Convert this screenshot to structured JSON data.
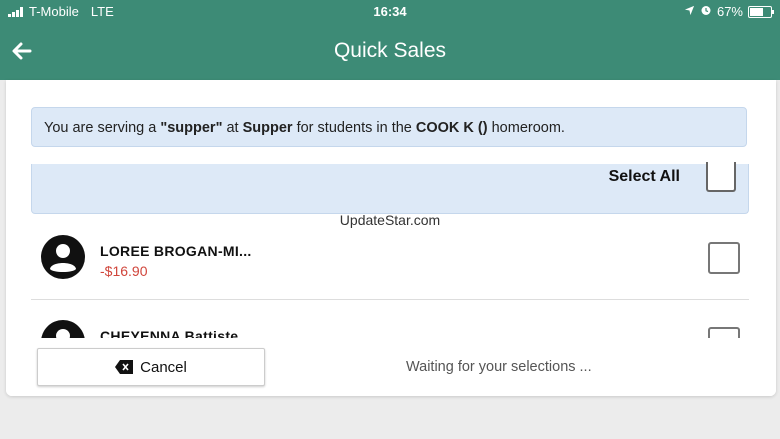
{
  "status_bar": {
    "carrier": "T-Mobile",
    "network": "LTE",
    "time": "16:34",
    "battery": "67%",
    "icons": [
      "location-arrow-icon",
      "alarm-icon",
      "battery-icon"
    ]
  },
  "header": {
    "title": "Quick Sales",
    "back_icon": "arrow-left-icon"
  },
  "banner": {
    "prefix": "You are serving a ",
    "meal": "\"supper\"",
    "at_text": " at ",
    "location": "Supper",
    "middle": " for students in the ",
    "homeroom": "COOK K ()",
    "suffix": " homeroom."
  },
  "select_all": {
    "label": "Select All"
  },
  "watermark": "UpdateStar.com",
  "students": [
    {
      "name": "LOREE BROGAN-MI...",
      "balance": "-$16.90"
    },
    {
      "name": "CHEYENNA Battiste",
      "balance": ""
    }
  ],
  "footer": {
    "cancel_label": "Cancel",
    "status_text": "Waiting for your selections ..."
  },
  "colors": {
    "header": "#3d8b76",
    "banner": "#dde9f7",
    "negative_balance": "#d0453b"
  }
}
